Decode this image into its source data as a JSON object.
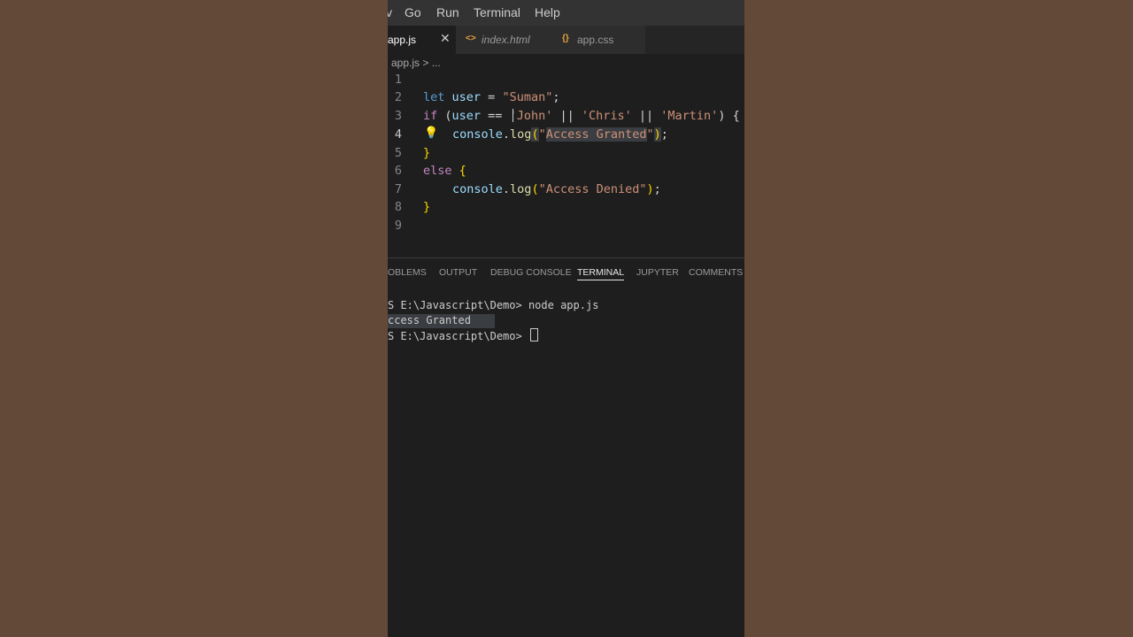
{
  "menu": [
    "v",
    "Go",
    "Run",
    "Terminal",
    "Help"
  ],
  "tabs": [
    {
      "label": "app.js",
      "active": true,
      "close": "✕"
    },
    {
      "label": "index.html",
      "icon": "<>"
    },
    {
      "label": "app.css",
      "icon": "{}"
    }
  ],
  "breadcrumb": "app.js > ...",
  "code": {
    "line_numbers": [
      "1",
      "2",
      "3",
      "4",
      "5",
      "6",
      "7",
      "8",
      "9"
    ],
    "l2": {
      "kw": "let",
      "var": "user",
      "eq": " = ",
      "str": "\"Suman\"",
      "end": ";"
    },
    "l3": {
      "kw": "if",
      "p1": " (",
      "var": "user",
      "op": " == ",
      "s1": "'John'",
      "or1": " || ",
      "s2": "'Chris'",
      "or2": " || ",
      "s3": "'Martin'",
      "end": ") {"
    },
    "l4": {
      "obj": "console",
      "dot": ".",
      "fn": "log",
      "open": "(",
      "q1": "\"",
      "str": "Access Granted",
      "q2": "\"",
      "close": ")",
      "end": ";"
    },
    "l5": {
      "brace": "}"
    },
    "l6": {
      "kw": "else",
      "brace": " {"
    },
    "l7": {
      "obj": "console",
      "dot": ".",
      "fn": "log",
      "open": "(",
      "str": "\"Access Denied\"",
      "close": ")",
      "end": ";"
    },
    "l8": {
      "brace": "}"
    }
  },
  "panel": {
    "tabs": [
      "OBLEMS",
      "OUTPUT",
      "DEBUG CONSOLE",
      "TERMINAL",
      "JUPYTER",
      "COMMENTS"
    ],
    "active": "TERMINAL"
  },
  "terminal": {
    "line1": "S E:\\Javascript\\Demo> node app.js",
    "line2": "ccess Granted",
    "line3": "S E:\\Javascript\\Demo> "
  },
  "colors": {
    "background": "#634a38",
    "editor": "#1e1e1e",
    "keyword": "#569cd6",
    "string": "#ce9178",
    "function": "#dcdcaa"
  }
}
